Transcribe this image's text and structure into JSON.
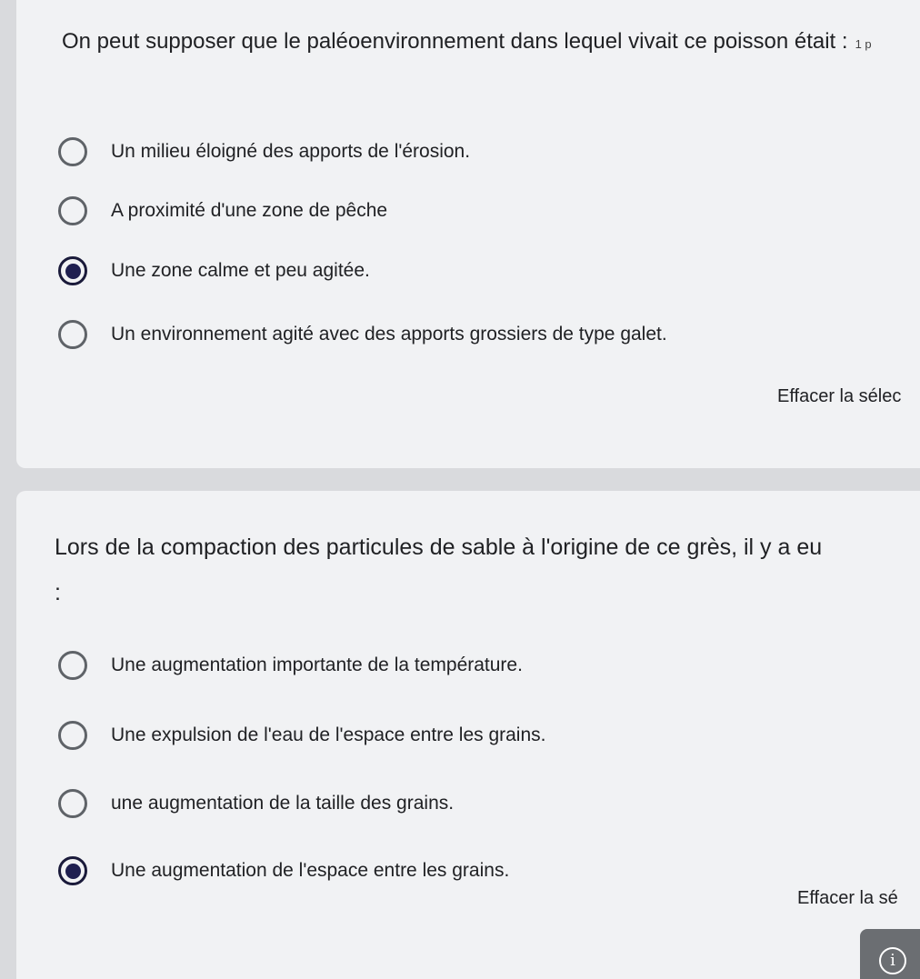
{
  "question1": {
    "title": "On peut supposer que le paléoenvironnement dans lequel vivait ce poisson était :",
    "points": "1 p",
    "options": [
      {
        "label": "Un milieu éloigné des apports de l'érosion.",
        "selected": false
      },
      {
        "label": "A proximité d'une zone de pêche",
        "selected": false
      },
      {
        "label": "Une zone calme et peu agitée.",
        "selected": true
      },
      {
        "label": "Un environnement agité avec des apports grossiers de type galet.",
        "selected": false
      }
    ],
    "clear_label": "Effacer la sélec"
  },
  "question2": {
    "title": "Lors de la compaction des particules de sable à l'origine de ce grès, il y a eu",
    "colon": ":",
    "options": [
      {
        "label": "Une augmentation importante de la température.",
        "selected": false
      },
      {
        "label": "Une expulsion de l'eau de l'espace entre les grains.",
        "selected": false
      },
      {
        "label": "une augmentation de la taille des grains.",
        "selected": false
      },
      {
        "label": "Une augmentation de l'espace entre les grains.",
        "selected": true
      }
    ],
    "clear_label": "Effacer la sé"
  },
  "info_button": {
    "icon": "info-icon",
    "glyph": "i"
  },
  "colors": {
    "background": "#d9dadd",
    "card": "#f1f2f4",
    "radio_selected": "#1f1f50",
    "radio_border": "#5f6368"
  }
}
